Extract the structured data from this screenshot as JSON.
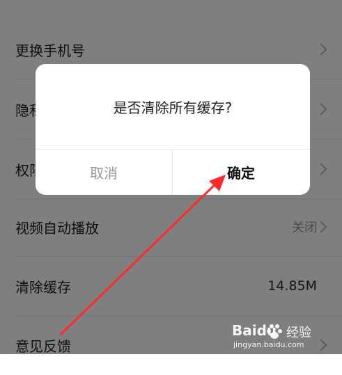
{
  "settings": {
    "rows": [
      {
        "label": "更换手机号",
        "value": ""
      },
      {
        "label": "隐私",
        "value": ""
      },
      {
        "label": "权限",
        "value": ""
      },
      {
        "label": "视频自动播放",
        "value": "关闭"
      },
      {
        "label": "清除缓存",
        "value": "14.85M"
      },
      {
        "label": "意见反馈",
        "value": ""
      }
    ]
  },
  "dialog": {
    "title": "是否清除所有缓存?",
    "cancel_label": "取消",
    "confirm_label": "确定"
  },
  "colors": {
    "annotation_arrow": "#ff2a2a",
    "overlay": "rgba(0,0,0,0.5)"
  },
  "watermark": {
    "brand": "Baidu",
    "text": "经验",
    "url": "jingyan.baidu.com"
  }
}
